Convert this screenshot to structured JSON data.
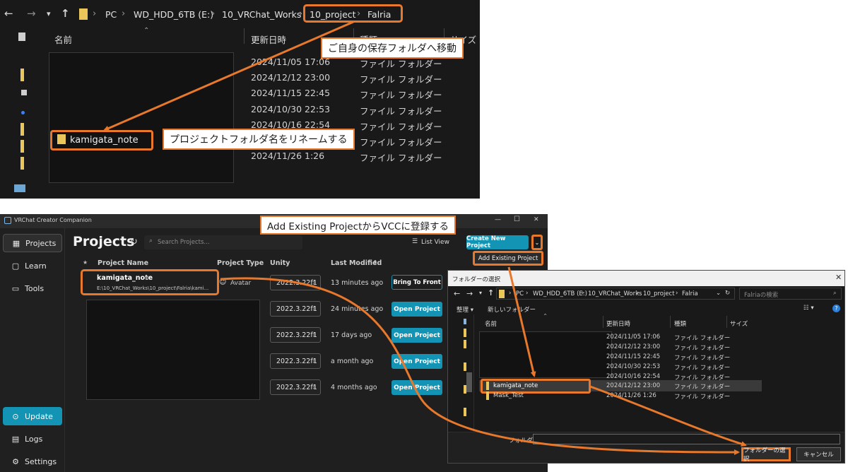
{
  "explorer": {
    "breadcrumb": [
      "PC",
      "WD_HDD_6TB (E:)",
      "10_VRChat_Works",
      "10_project",
      "Falria"
    ],
    "col_name": "名前",
    "col_date": "更新日時",
    "col_type": "種類",
    "col_size": "サイズ",
    "rows": [
      {
        "date": "2024/11/05 17:06",
        "type": "ファイル フォルダー"
      },
      {
        "date": "2024/12/12 23:00",
        "type": "ファイル フォルダー"
      },
      {
        "date": "2024/11/15 22:45",
        "type": "ファイル フォルダー"
      },
      {
        "date": "2024/10/30 22:53",
        "type": "ファイル フォルダー"
      },
      {
        "date": "2024/10/16 22:54",
        "type": "ファイル フォルダー"
      },
      {
        "date": "",
        "type": "ファイル フォルダー"
      },
      {
        "date": "2024/11/26 1:26",
        "type": "ファイル フォルダー"
      }
    ],
    "renamed_folder": "kamigata_note"
  },
  "callouts": {
    "move_folder": "ご自身の保存フォルダへ移動",
    "rename": "プロジェクトフォルダ名をリネームする",
    "add_existing": "Add Existing ProjectからVCCに登録する"
  },
  "vcc": {
    "app_title": "VRChat Creator Companion",
    "window_controls": [
      "—",
      "☐",
      "✕"
    ],
    "sidebar": {
      "projects": "Projects",
      "learn": "Learn",
      "tools": "Tools",
      "update": "Update",
      "logs": "Logs",
      "settings": "Settings"
    },
    "page_title": "Projects",
    "search_placeholder": "Search Projects...",
    "list_view": "List View",
    "create_new": "Create New Project",
    "add_existing": "Add Existing Project",
    "headers": {
      "name": "Project Name",
      "type": "Project Type",
      "unity": "Unity",
      "last_modified": "Last Modified"
    },
    "rows": [
      {
        "name": "kamigata_note",
        "path": "E:\\10_VRChat_Works\\10_project\\Falria\\kami...",
        "type": "Avatar",
        "unity": "2022.3.22f1",
        "modified": "13 minutes ago",
        "action": "Bring To Front"
      },
      {
        "unity": "2022.3.22f1",
        "modified": "24 minutes ago",
        "action": "Open Project"
      },
      {
        "unity": "2022.3.22f1",
        "modified": "17 days ago",
        "action": "Open Project"
      },
      {
        "unity": "2022.3.22f1",
        "modified": "a month ago",
        "action": "Open Project"
      },
      {
        "unity": "2022.3.22f1",
        "modified": "4 months ago",
        "action": "Open Project"
      }
    ]
  },
  "dialog": {
    "title": "フォルダーの選択",
    "breadcrumb": [
      "PC",
      "WD_HDD_6TB (E:)",
      "10_VRChat_Works",
      "10_project",
      "Falria"
    ],
    "search_placeholder": "Falriaの検索",
    "organize": "整理 ▾",
    "new_folder": "新しいフォルダー",
    "col_name": "名前",
    "col_date": "更新日時",
    "col_type": "種類",
    "col_size": "サイズ",
    "rows": [
      {
        "date": "2024/11/05 17:06",
        "type": "ファイル フォルダー"
      },
      {
        "date": "2024/12/12 23:00",
        "type": "ファイル フォルダー"
      },
      {
        "date": "2024/11/15 22:45",
        "type": "ファイル フォルダー"
      },
      {
        "date": "2024/10/30 22:53",
        "type": "ファイル フォルダー"
      },
      {
        "date": "2024/10/16 22:54",
        "type": "ファイル フォルダー"
      },
      {
        "name": "kamigata_note",
        "date": "2024/12/12 23:00",
        "type": "ファイル フォルダー"
      },
      {
        "name": "Mask_Test",
        "date": "2024/11/26 1:26",
        "type": "ファイル フォルダー"
      }
    ],
    "folder_label": "フォルダー:",
    "select_button": "フォルダーの選択",
    "cancel_button": "キャンセル"
  }
}
